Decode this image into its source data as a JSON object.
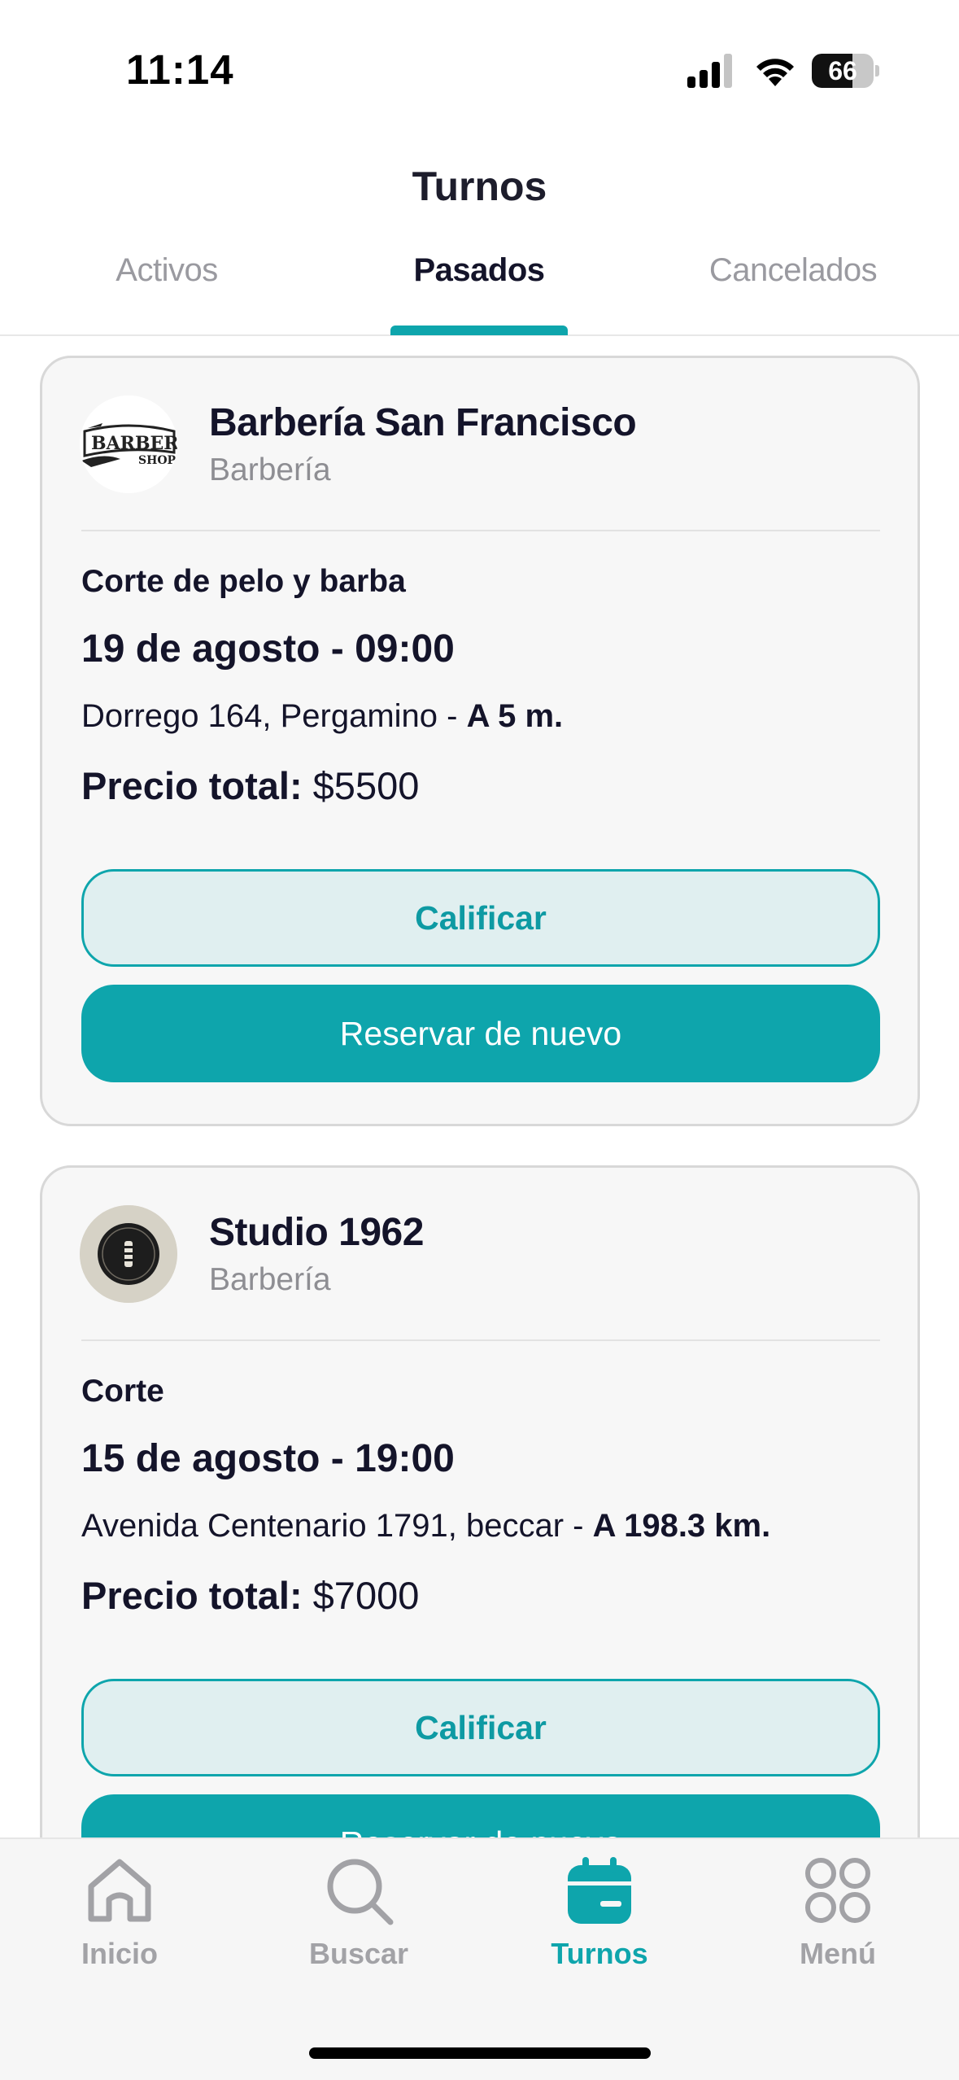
{
  "status_bar": {
    "time": "11:14",
    "battery": "66",
    "battery_level": 0.66
  },
  "header": {
    "title": "Turnos"
  },
  "tabs": [
    {
      "label": "Activos",
      "active": false
    },
    {
      "label": "Pasados",
      "active": true
    },
    {
      "label": "Cancelados",
      "active": false
    }
  ],
  "appointments": [
    {
      "shop_name": "Barbería San Francisco",
      "category": "Barbería",
      "logo_text_1": "BARBER",
      "logo_text_2": "SHOP",
      "service": "Corte de pelo y barba",
      "datetime": "19 de agosto - 09:00",
      "address": "Dorrego 164, Pergamino",
      "address_sep": " - ",
      "distance": "A 5 m.",
      "price_label": "Precio total:",
      "price": "$5500",
      "rate_label": "Calificar",
      "book_label": "Reservar de nuevo"
    },
    {
      "shop_name": "Studio 1962",
      "category": "Barbería",
      "service": "Corte",
      "datetime": "15 de agosto - 19:00",
      "address": "Avenida Centenario 1791, beccar",
      "address_sep": " - ",
      "distance": "A 198.3 km.",
      "price_label": "Precio total:",
      "price": "$7000",
      "rate_label": "Calificar",
      "book_label": "Reservar de nuevo"
    }
  ],
  "nav": [
    {
      "label": "Inicio",
      "icon": "home-icon",
      "active": false
    },
    {
      "label": "Buscar",
      "icon": "search-icon",
      "active": false
    },
    {
      "label": "Turnos",
      "icon": "calendar-icon",
      "active": true
    },
    {
      "label": "Menú",
      "icon": "grid-icon",
      "active": false
    }
  ],
  "colors": {
    "accent": "#0ea5ac",
    "accent_light": "#e0eff0",
    "text": "#14142a",
    "muted": "#8e8e93"
  }
}
